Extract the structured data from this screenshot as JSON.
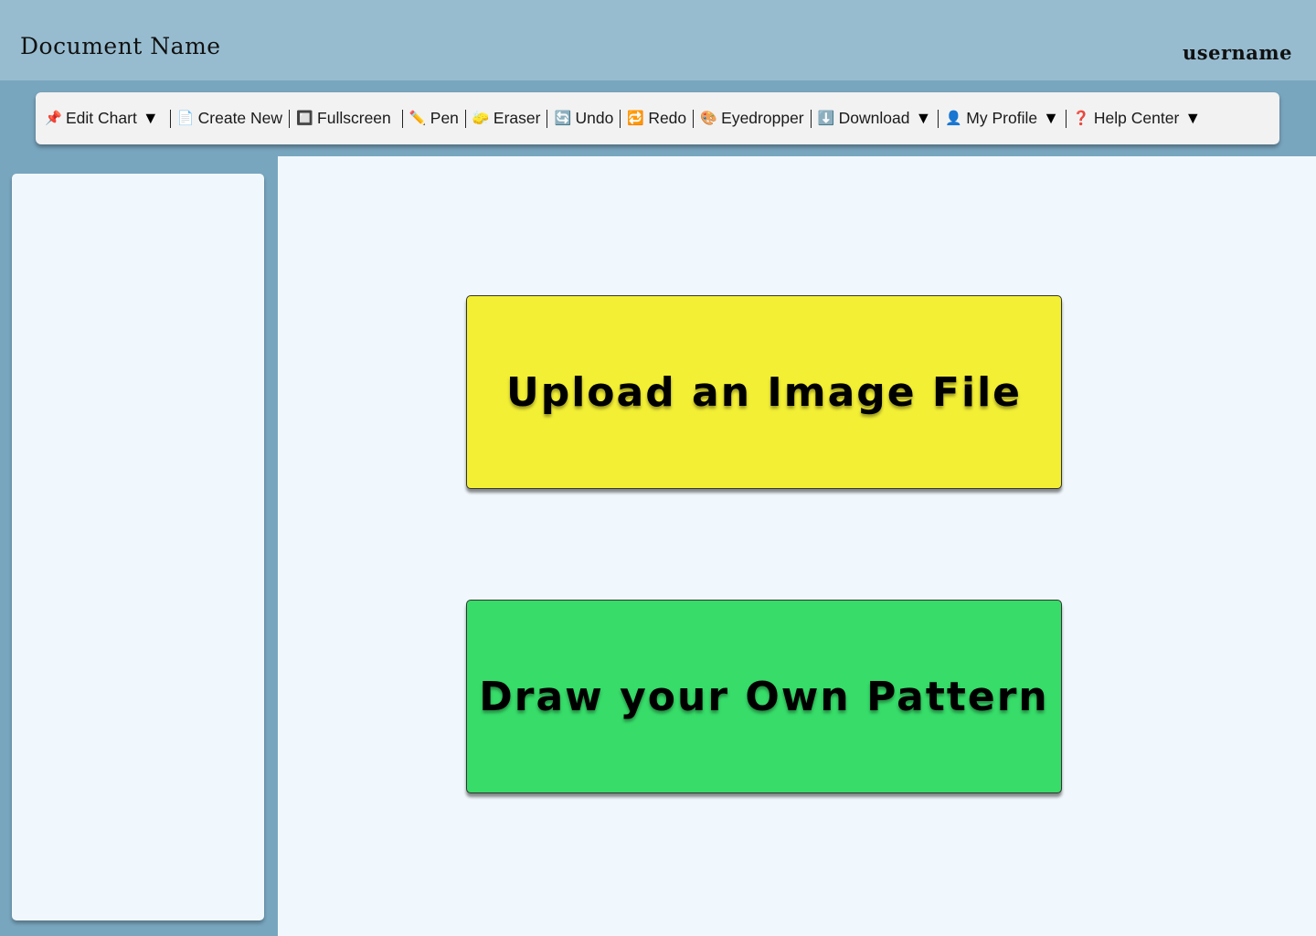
{
  "header": {
    "document_name": "Document Name",
    "username": "username"
  },
  "toolbar": {
    "items": [
      {
        "label": "Edit Chart",
        "icon": "pin-icon",
        "glyph": "📌",
        "dropdown": true
      },
      {
        "label": "Create New",
        "icon": "document-icon",
        "glyph": "📄",
        "dropdown": false
      },
      {
        "label": "Fullscreen",
        "icon": "fullscreen-icon",
        "glyph": "🔲",
        "dropdown": false
      },
      {
        "label": "Pen",
        "icon": "pencil-icon",
        "glyph": "✏️",
        "dropdown": false
      },
      {
        "label": "Eraser",
        "icon": "eraser-icon",
        "glyph": "🧽",
        "dropdown": false
      },
      {
        "label": "Undo",
        "icon": "undo-icon",
        "glyph": "🔄",
        "dropdown": false
      },
      {
        "label": "Redo",
        "icon": "redo-icon",
        "glyph": "🔁",
        "dropdown": false
      },
      {
        "label": "Eyedropper",
        "icon": "palette-icon",
        "glyph": "🎨",
        "dropdown": false
      },
      {
        "label": "Download",
        "icon": "download-icon",
        "glyph": "⬇️",
        "dropdown": true
      },
      {
        "label": "My Profile",
        "icon": "user-icon",
        "glyph": "👤",
        "dropdown": true
      },
      {
        "label": "Help Center",
        "icon": "question-icon",
        "glyph": "❓",
        "dropdown": true
      }
    ],
    "caret": "▼"
  },
  "main": {
    "upload_label": "Upload an Image File",
    "draw_label": "Draw your Own Pattern"
  },
  "colors": {
    "header_bg": "#97bcd0",
    "page_bg": "#79a6bf",
    "panel_bg": "#f1f8fd",
    "upload_bg": "#f3ef35",
    "draw_bg": "#37dc69"
  }
}
